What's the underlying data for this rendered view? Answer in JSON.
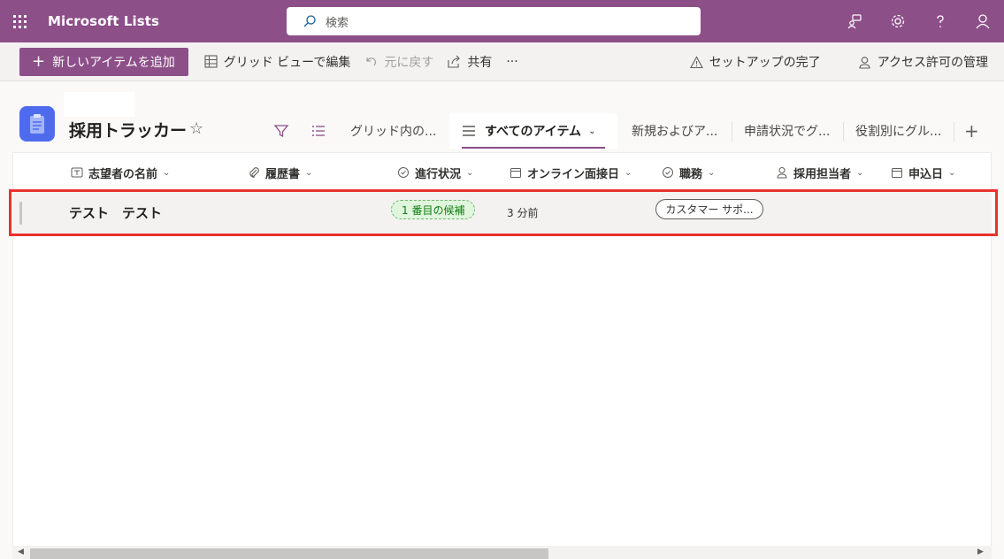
{
  "header": {
    "app_name": "Microsoft Lists",
    "search_placeholder": "検索"
  },
  "commands": {
    "new_item": "新しいアイテムを追加",
    "grid_edit": "グリッド ビューで編集",
    "undo": "元に戻す",
    "share": "共有",
    "more": "···",
    "setup": "セットアップの完了",
    "access": "アクセス許可の管理"
  },
  "list": {
    "title": "採用トラッカー"
  },
  "views": {
    "tabs": [
      "グリッド内の...",
      "すべてのアイテム",
      "新規およびア...",
      "申請状況でグ...",
      "役割別にグル..."
    ],
    "active_index": 1,
    "add": "+"
  },
  "columns": [
    "志望者の名前",
    "履歴書",
    "進行状況",
    "オンライン面接日",
    "職務",
    "採用担当者",
    "申込日"
  ],
  "rows": [
    {
      "name": "テスト　テスト",
      "status": "1 番目の候補",
      "interview": "3 分前",
      "job": "カスタマー サポ..."
    }
  ],
  "colors": {
    "brand": "#8c4f88",
    "status_green": "#107c10",
    "highlight": "#e8322d"
  }
}
